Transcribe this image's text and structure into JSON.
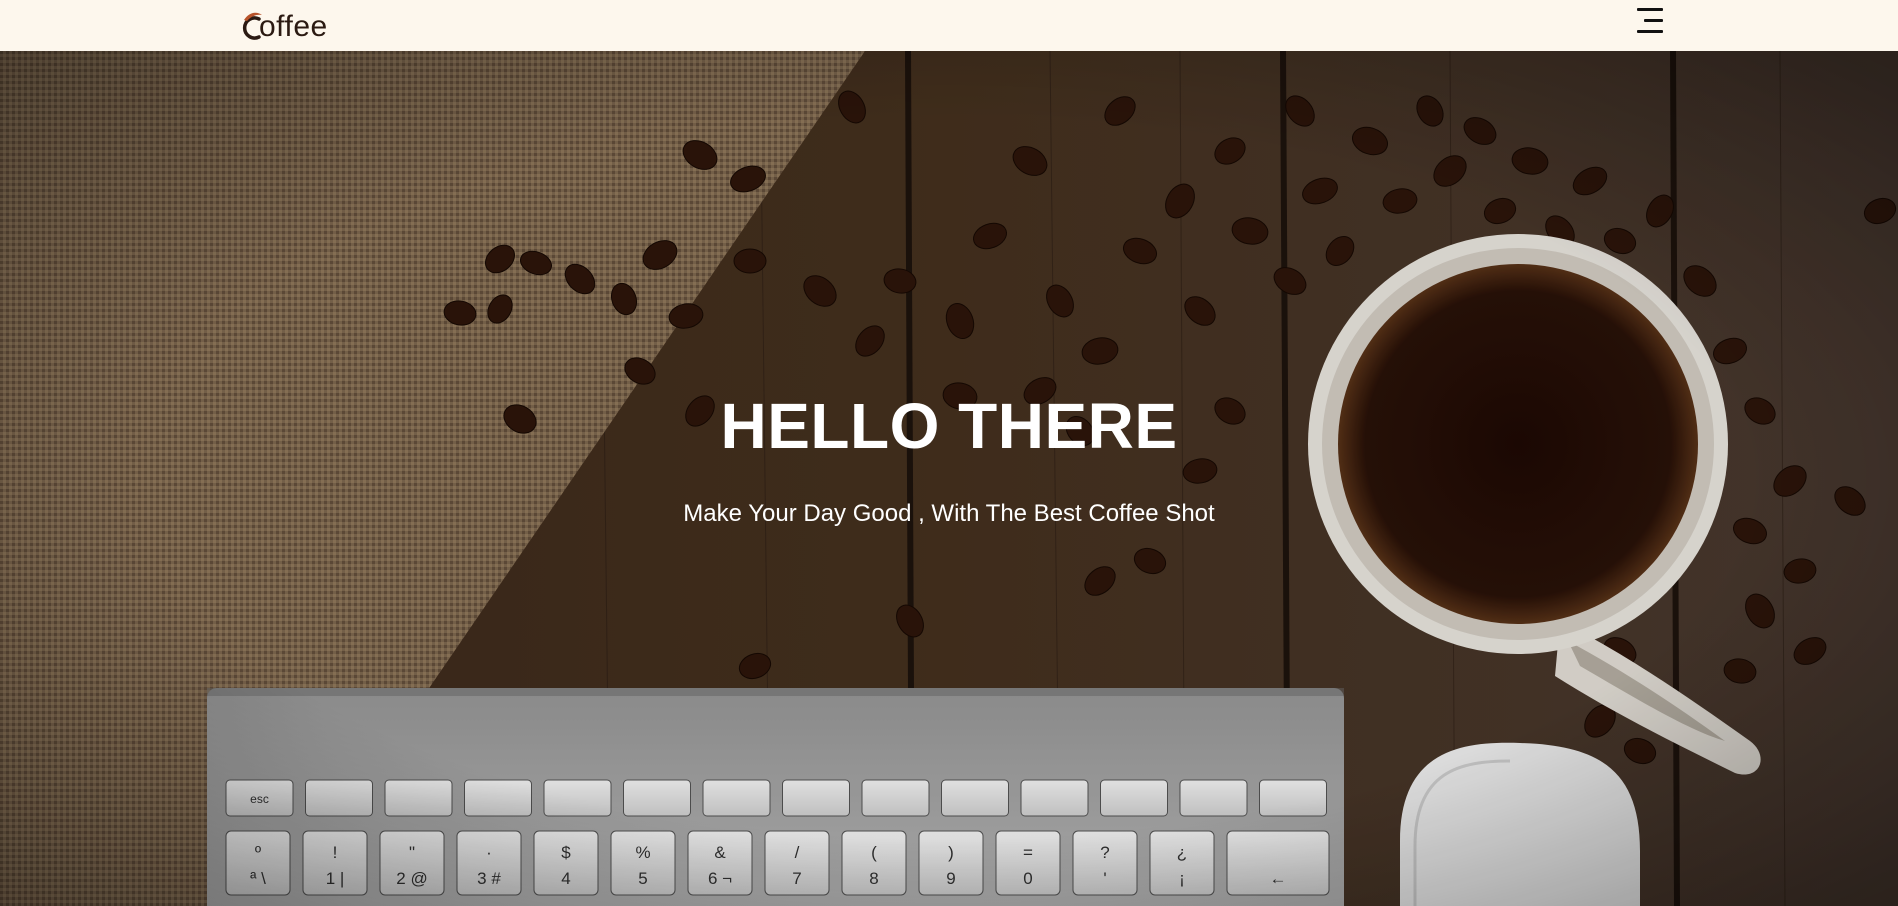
{
  "header": {
    "logo_text": "offee",
    "logo_icon": "coffee-c-logo",
    "menu_icon": "hamburger-menu-icon"
  },
  "hero": {
    "title": "HELLO THERE",
    "subtitle": "Make Your Day Good , With The Best Coffee Shot"
  },
  "keyboard": {
    "row1": [
      "esc",
      "",
      "",
      "",
      "",
      "",
      "",
      "",
      "",
      "",
      "",
      "",
      "",
      ""
    ],
    "row2": [
      "º",
      "!",
      "\"",
      "·",
      "$",
      "%",
      "&",
      "/",
      "(",
      ")",
      "=",
      "?",
      "¿",
      ""
    ],
    "row2_bottom": [
      "ª \\",
      "1 |",
      "2 @",
      "3 #",
      "4",
      "5",
      "6 ¬",
      "7",
      "8",
      "9",
      "0",
      "'",
      "¡",
      "←"
    ]
  },
  "colors": {
    "nav_bg": "#fdf7ed",
    "logo_color": "#2b1a12",
    "wood": "#3d2a1f",
    "burlap": "#8a7156"
  }
}
